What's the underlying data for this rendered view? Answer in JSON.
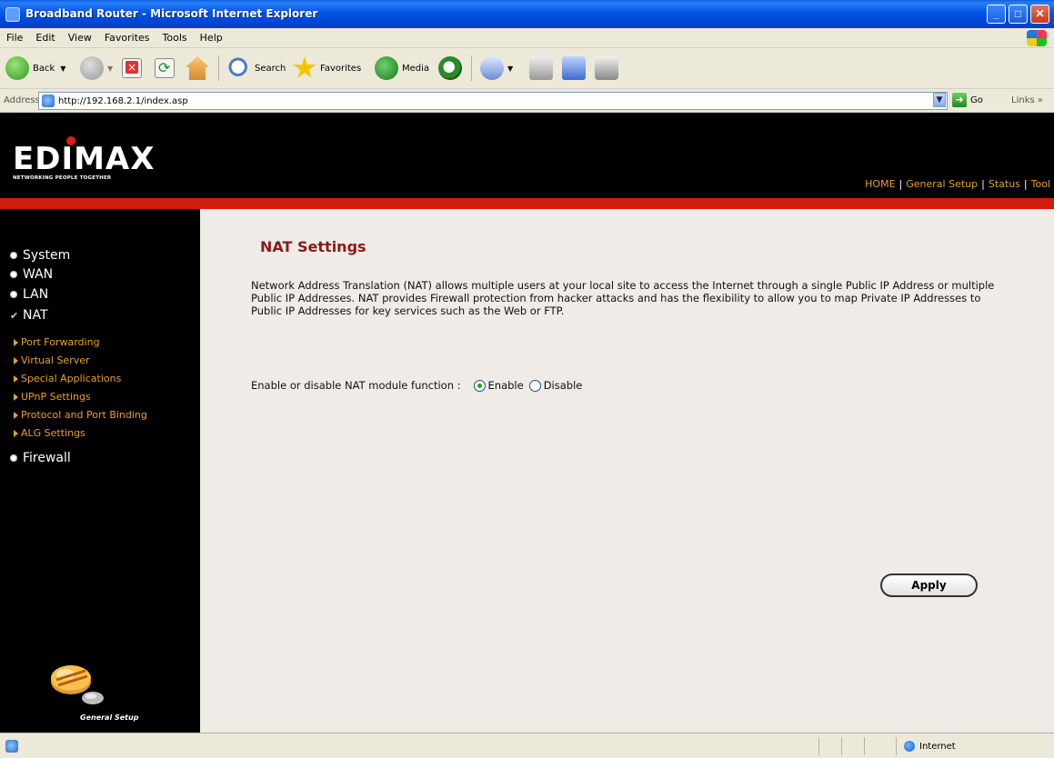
{
  "window": {
    "title": "Broadband Router - Microsoft Internet Explorer",
    "buttons": {
      "minimize": "_",
      "maximize": "□",
      "close": "✕"
    }
  },
  "menu": [
    "File",
    "Edit",
    "View",
    "Favorites",
    "Tools",
    "Help"
  ],
  "toolbar": {
    "back": "Back",
    "search": "Search",
    "favorites": "Favorites",
    "media": "Media"
  },
  "address": {
    "label": "Address",
    "url": "http://192.168.2.1/index.asp",
    "go": "Go",
    "links": "Links »"
  },
  "brand": {
    "logo": "EDIMAX",
    "tagline": "NETWORKING PEOPLE TOGETHER"
  },
  "topnav": [
    "HOME",
    "General Setup",
    "Status",
    "Tool"
  ],
  "sidebar": {
    "items": [
      "System",
      "WAN",
      "LAN",
      "NAT",
      "Firewall"
    ],
    "nat_subitems": [
      "Port Forwarding",
      "Virtual Server",
      "Special Applications",
      "UPnP Settings",
      "Protocol and Port Binding",
      "ALG Settings"
    ],
    "caption": "General Setup"
  },
  "content": {
    "title": "NAT Settings",
    "description": "Network Address Translation (NAT) allows multiple users at your local site to access the Internet through a single Public IP Address or multiple Public IP Addresses. NAT provides Firewall protection from hacker attacks and has the flexibility to allow you to map Private IP Addresses to Public IP Addresses for key services such as the Web or FTP.",
    "nat_label": "Enable or disable NAT module function :",
    "options": [
      "Enable",
      "Disable"
    ],
    "selected": "Enable",
    "apply": "Apply"
  },
  "status": {
    "zone": "Internet"
  },
  "colors": {
    "accent_red": "#d21b0f",
    "menu_orange": "#e8a030",
    "title_dark_red": "#8b1a1a"
  }
}
